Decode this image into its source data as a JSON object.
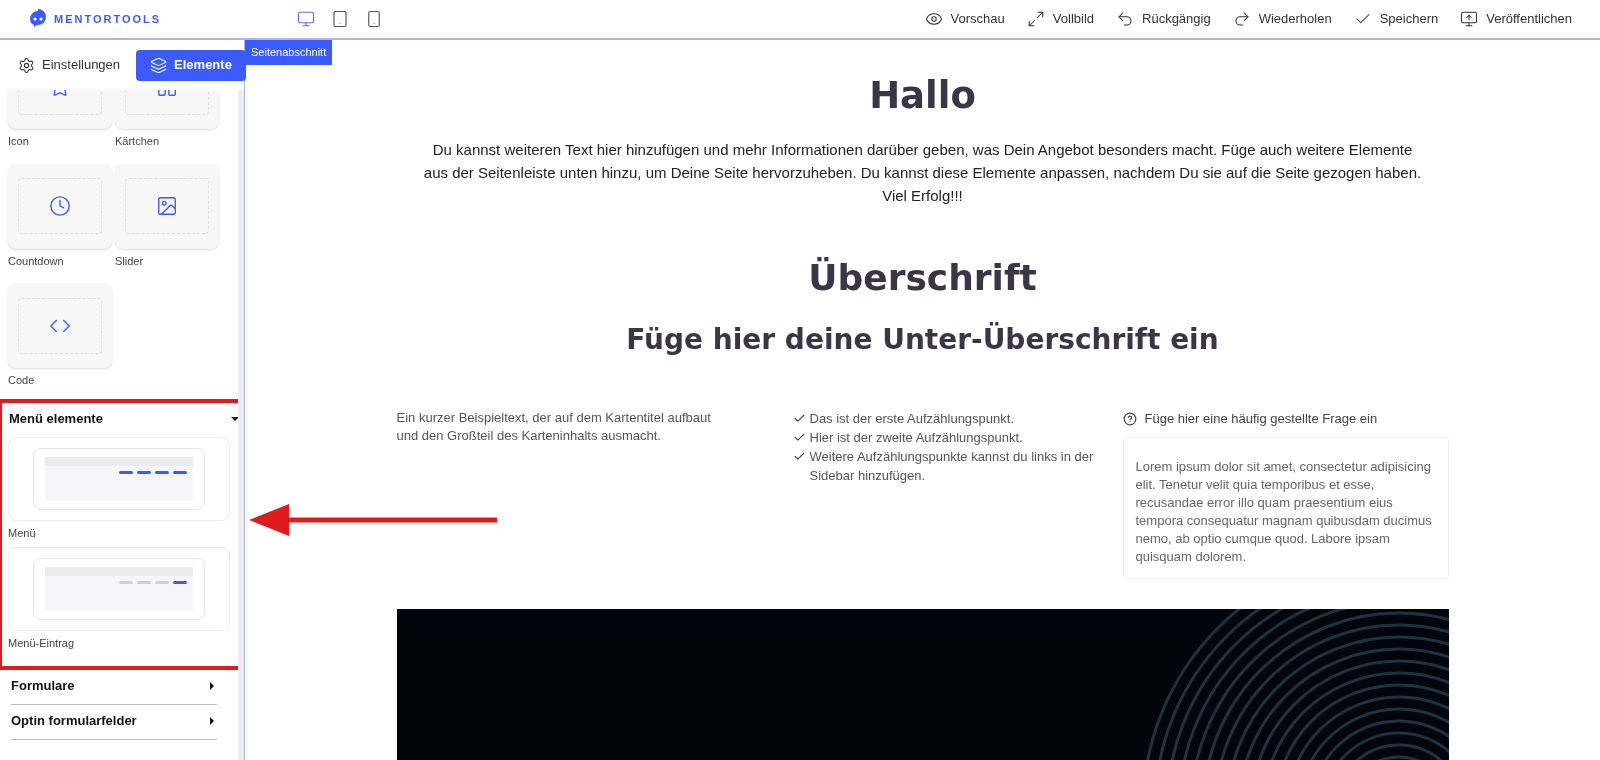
{
  "header": {
    "logo": "MENTORTOOLS",
    "devices": [
      {
        "kind": "desktop",
        "selected": true
      },
      {
        "kind": "tablet",
        "selected": false
      },
      {
        "kind": "mobile",
        "selected": false
      }
    ],
    "actions": [
      {
        "kind": "preview",
        "label": "Vorschau"
      },
      {
        "kind": "fullscreen",
        "label": "Vollbild"
      },
      {
        "kind": "undo",
        "label": "Rückgängig"
      },
      {
        "kind": "redo",
        "label": "Wiederholen"
      },
      {
        "kind": "save",
        "label": "Speichern"
      },
      {
        "kind": "publish",
        "label": "Veröffentlichen"
      }
    ]
  },
  "sidebar": {
    "tabs": [
      {
        "kind": "settings",
        "label": "Einstellungen",
        "selected": false
      },
      {
        "kind": "layers",
        "label": "Elemente",
        "selected": true
      }
    ],
    "elements": [
      {
        "kind": "icon",
        "label": "Icon"
      },
      {
        "kind": "card",
        "label": "Kärtchen"
      },
      {
        "kind": "clock",
        "label": "Countdown"
      },
      {
        "kind": "image",
        "label": "Slider"
      },
      {
        "kind": "code",
        "label": "Code"
      }
    ],
    "sections": [
      {
        "title": "Menü elemente",
        "expanded": true,
        "highlighted": true,
        "items": [
          {
            "kind": "menu",
            "label": "Menü"
          },
          {
            "kind": "menu-item",
            "label": "Menü-Eintrag"
          }
        ]
      },
      {
        "title": "Formulare",
        "expanded": false,
        "highlighted": false
      },
      {
        "title": "Optin formularfelder",
        "expanded": false,
        "highlighted": false
      }
    ]
  },
  "canvas": {
    "section_label": "Seitenabschnitt",
    "heading": "Hallo",
    "intro": "Du kannst weiteren Text hier hinzufügen und mehr Informationen darüber geben, was Dein Angebot besonders macht. Füge auch weitere Elemente aus der Seitenleiste unten hinzu, um Deine Seite hervorzuheben. Du kannst diese Elemente anpassen, nachdem Du sie auf die Seite gezogen haben. Viel Erfolg!!!",
    "heading2": "Überschrift",
    "subheading": "Füge hier deine Unter-Überschrift ein",
    "card_text": "Ein kurzer Beispieltext, der auf dem Kartentitel aufbaut und den Großteil des Karteninhalts ausmacht.",
    "bullets": [
      "Das ist der erste Aufzählungspunkt.",
      "Hier ist der zweite Aufzählungspunkt.",
      "Weitere Aufzählungspunkte kannst du links in der Sidebar hinzufügen."
    ],
    "faq": {
      "question": "Füge hier eine häufig gestellte Frage ein",
      "answer": "Lorem ipsum dolor sit amet, consectetur adipisicing elit. Tenetur velit quia temporibus et esse, recusandae error illo quam praesentium eius tempora consequatur magnam quibusdam ducimus nemo, ab optio cumque quod. Labore ipsam quisquam dolorem."
    }
  }
}
